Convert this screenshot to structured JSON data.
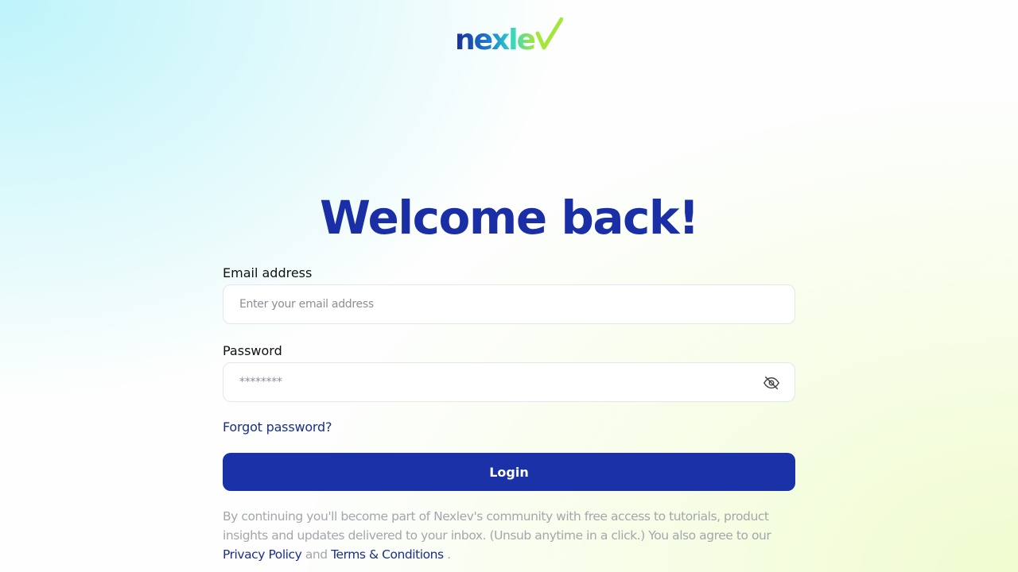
{
  "brand": {
    "logo_text": "nexlev",
    "colors": {
      "primary": "#1a31a8",
      "heading": "#1a2fa6",
      "link": "#1a2f8a",
      "logo_gradient_start": "#1a2a9a",
      "logo_gradient_end": "#a6e63a"
    }
  },
  "page": {
    "title": "Welcome back!"
  },
  "form": {
    "email": {
      "label": "Email address",
      "placeholder": "Enter your email address",
      "value": ""
    },
    "password": {
      "label": "Password",
      "placeholder": "********",
      "value": "",
      "toggle_icon": "eye-off-icon"
    },
    "forgot_password_label": "Forgot password?",
    "login_button_label": "Login"
  },
  "disclaimer": {
    "text": "By continuing you'll become part of Nexlev's community with free access to tutorials, product insights and updates delivered to your inbox. (Unsub anytime in a click.) You also agree to our",
    "privacy_link": "Privacy Policy",
    "and_text": "and",
    "terms_link": "Terms & Conditions",
    "end_text": "."
  }
}
